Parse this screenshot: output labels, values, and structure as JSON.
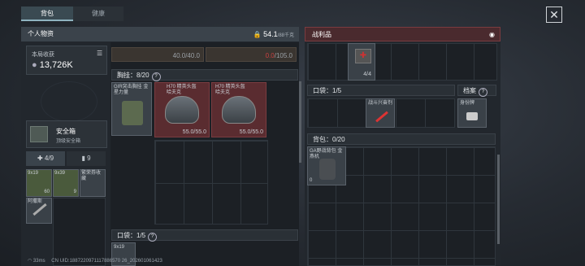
{
  "tabs": [
    {
      "label": "背包",
      "active": true
    },
    {
      "label": "健康",
      "active": false
    }
  ],
  "close_icon": "close-x-icon",
  "left_panel": {
    "title": "个人物资",
    "weight_value": "54.1",
    "weight_unit": "/88千克",
    "earnings_label": "本局收获",
    "earnings_value": "13,726K",
    "safe_box_name": "安全箱",
    "safe_box_sub": "顶级安全箱",
    "bottom_tabs": [
      "4/9",
      "9"
    ],
    "items": [
      {
        "name": "9x19",
        "count": "60"
      },
      {
        "name": "9x39",
        "count": "9"
      },
      {
        "name": "繁荣券收藏"
      },
      {
        "name": "阿撒斯"
      }
    ]
  },
  "center_panel": {
    "durability_left": "40.0/40.0",
    "durability_right_red": "0.0",
    "durability_right_rest": "/105.0",
    "vest_section": "胸挂：8/20",
    "vest_item": "GIR突击胸挂 金星力量",
    "helmets": [
      {
        "name": "H70 精英头盔",
        "sub": "哈夫克",
        "durability": "55.0/55.0"
      },
      {
        "name": "H70 精英头盔",
        "sub": "哈夫克",
        "durability": "55.0/55.0"
      }
    ],
    "pocket_section": "口袋：1/5",
    "pocket_item": "9x19"
  },
  "right_panel": {
    "title": "战利品",
    "top_count": "4/4",
    "pocket_section": "口袋：1/5",
    "pocket_item": "战斗兴奋剂",
    "dossier_label": "档案",
    "dossier_item": "身份牌",
    "backpack_section": "背包：0/20",
    "backpack_item": "GA野战背包 金燕机",
    "backpack_badge": "0"
  },
  "footer": {
    "ping": "33ms",
    "uid": "CN UID:1887220971117886570 26_202601061423"
  }
}
